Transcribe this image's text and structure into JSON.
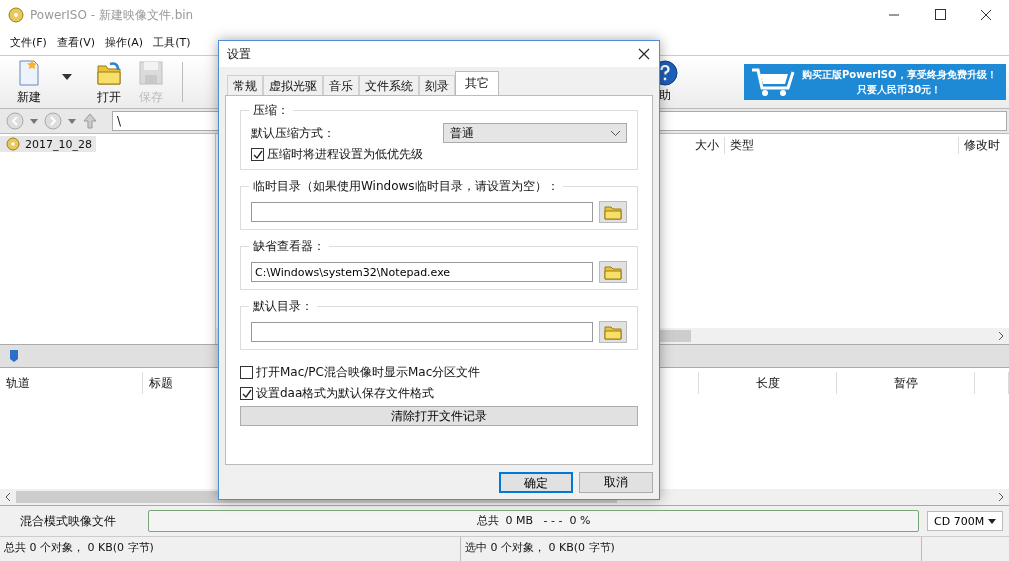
{
  "window": {
    "title": "PowerISO - 新建映像文件.bin"
  },
  "menu": [
    {
      "label": "文件(F)"
    },
    {
      "label": "查看(V)"
    },
    {
      "label": "操作(A)"
    },
    {
      "label": "工具(T)"
    }
  ],
  "toolbar": [
    {
      "label": "新建",
      "kind": "new",
      "dropdown": true,
      "disabled": false
    },
    {
      "label": "打开",
      "kind": "open",
      "dropdown": false,
      "disabled": false
    },
    {
      "label": "保存",
      "kind": "save",
      "dropdown": false,
      "disabled": true
    }
  ],
  "help_button": {
    "label": "助"
  },
  "banner": {
    "line_1": "购买正版PowerISO，享受终身免费升级！",
    "line_2": "只要人民币30元！"
  },
  "address": {
    "value": "\\"
  },
  "tree": [
    {
      "label": "2017_10_28",
      "selected": true
    }
  ],
  "slider": {
    "level": 0
  },
  "file_columns": [
    "大小",
    "类型",
    "修改时"
  ],
  "track_columns": [
    "轨道",
    "标题",
    "长度",
    "暂停"
  ],
  "image_type": "混合模式映像文件",
  "capacity": {
    "label": "总共  0 MB   - - -  0 %",
    "level": 0
  },
  "disc_size": "CD 700M",
  "status_bar": [
    "总共 0 个对象， 0 KB(0 字节)",
    "选中 0 个对象， 0 KB(0 字节)"
  ],
  "dialog": {
    "title": "设置",
    "tabs": [
      {
        "label": "常规",
        "selected": false
      },
      {
        "label": "虚拟光驱",
        "selected": false
      },
      {
        "label": "音乐",
        "selected": false
      },
      {
        "label": "文件系统",
        "selected": false
      },
      {
        "label": "刻录",
        "selected": false
      },
      {
        "label": "其它",
        "selected": true
      }
    ],
    "compression": {
      "legend": "压缩：",
      "method_label": "默认压缩方式：",
      "method": "普通",
      "low_priority": {
        "label": "压缩时将进程设置为低优先级",
        "checked": true
      }
    },
    "paths": [
      {
        "legend": "临时目录（如果使用Windows临时目录，请设置为空）："
      },
      {
        "legend": "缺省查看器：",
        "value": "C:\\Windows\\system32\\Notepad.exe"
      },
      {
        "legend": "默认目录："
      }
    ],
    "options": [
      {
        "label": "打开Mac/PC混合映像时显示Mac分区文件",
        "checked": false
      },
      {
        "label": "设置daa格式为默认保存文件格式",
        "checked": true
      }
    ],
    "clear_button": "清除打开文件记录",
    "buttons": [
      {
        "label": "确定",
        "default": true
      },
      {
        "label": "取消",
        "default": false
      }
    ]
  }
}
